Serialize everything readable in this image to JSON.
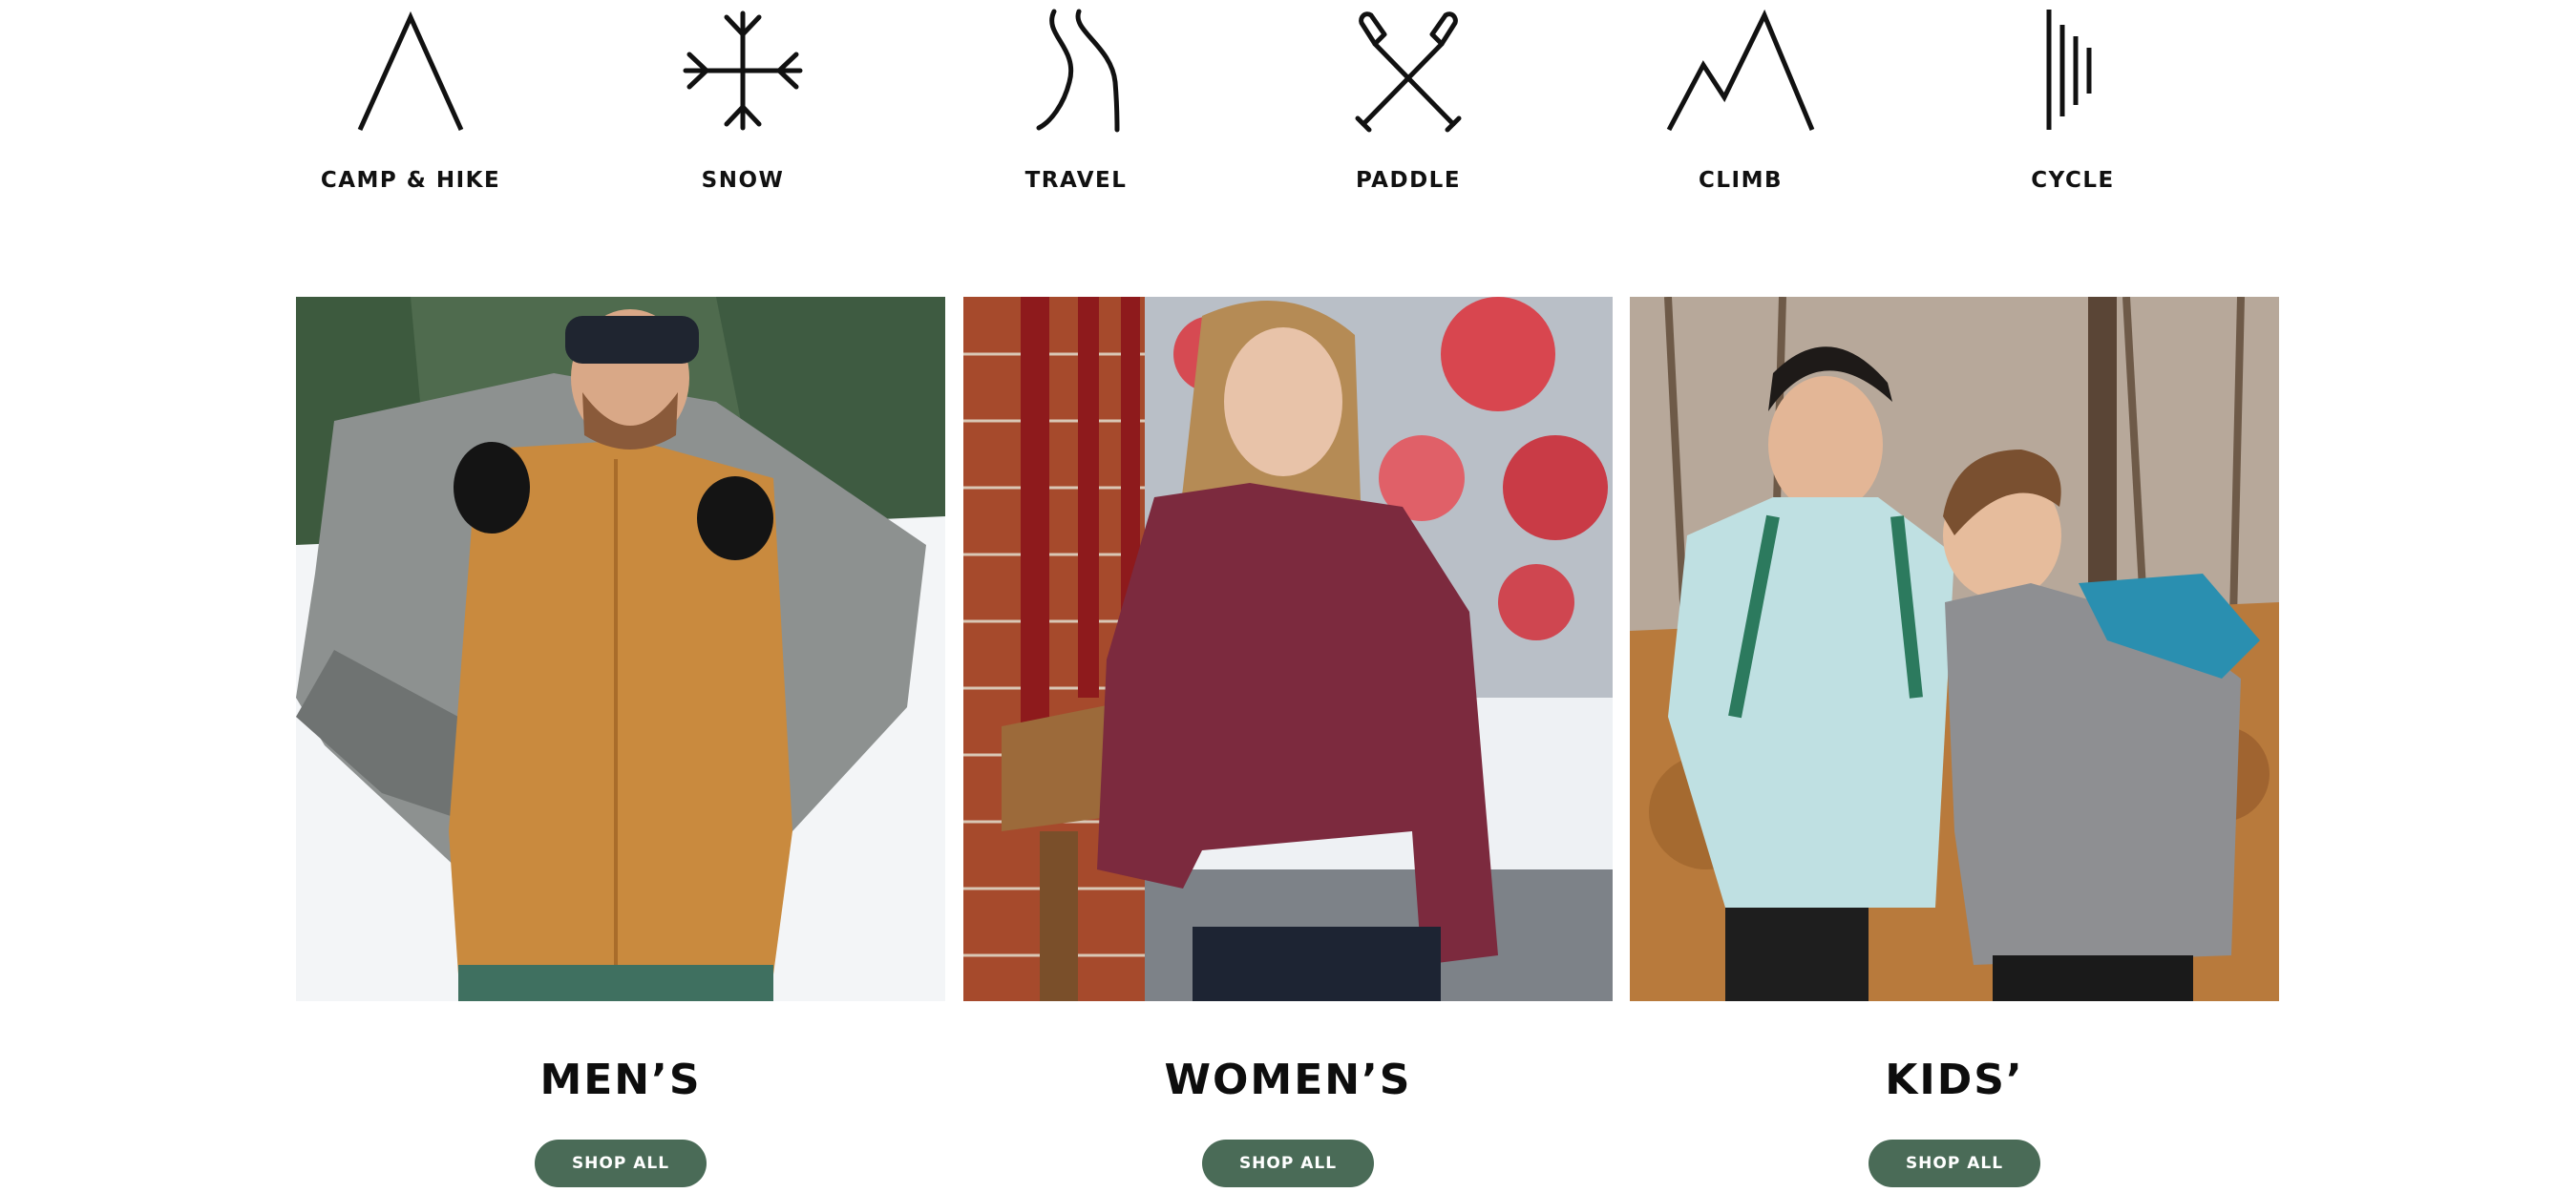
{
  "activities": [
    {
      "label": "CAMP & HIKE",
      "icon": "tent-icon"
    },
    {
      "label": "SNOW",
      "icon": "snowflake-icon"
    },
    {
      "label": "TRAVEL",
      "icon": "winding-road-icon"
    },
    {
      "label": "PADDLE",
      "icon": "crossed-paddles-icon"
    },
    {
      "label": "CLIMB",
      "icon": "mountain-peaks-icon"
    },
    {
      "label": "CYCLE",
      "icon": "speed-lines-icon"
    }
  ],
  "categories": [
    {
      "title": "MEN’S",
      "button": "SHOP ALL"
    },
    {
      "title": "WOMEN’S",
      "button": "SHOP ALL"
    },
    {
      "title": "KIDS’",
      "button": "SHOP ALL"
    }
  ],
  "colors": {
    "button_bg": "#4a6b57",
    "button_text": "#ffffff",
    "heading": "#0d0d0d"
  }
}
